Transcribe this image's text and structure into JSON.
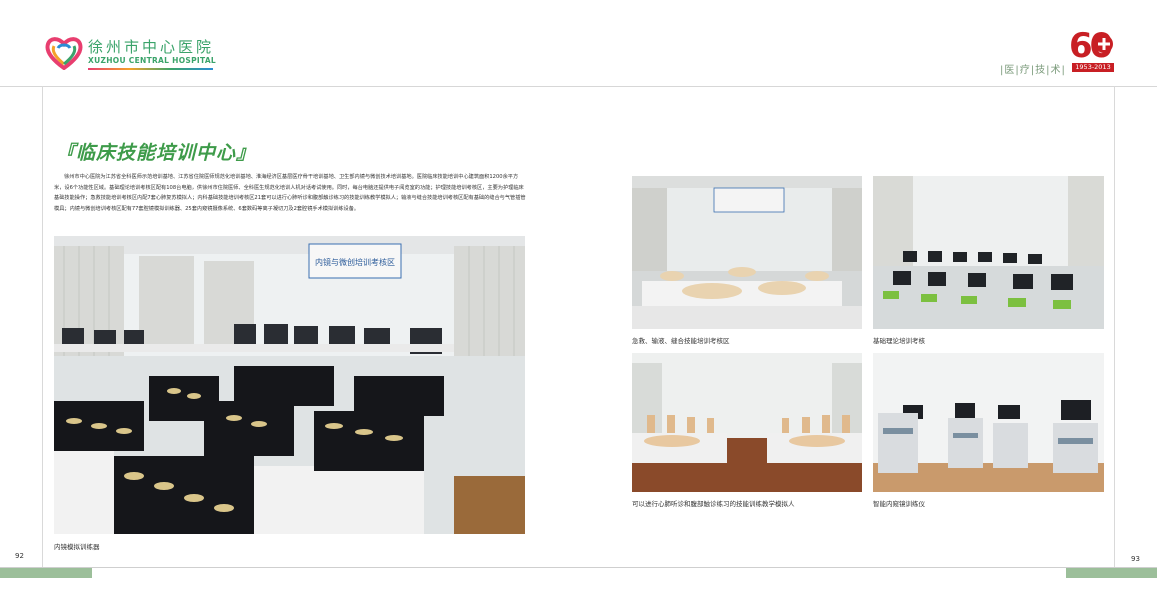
{
  "header": {
    "logo_cn": "徐州市中心医院",
    "logo_en": "XUZHOU CENTRAL HOSPITAL",
    "anniversary_mark": "60",
    "anniversary_years": "1953-2013",
    "section_tag": "|医|疗|技|术|"
  },
  "left_page": {
    "title": "『临床技能培训中心』",
    "body": "徐州市中心医院为江苏省全科医师示范培训基地、江苏省住院医师规范化培训基地、淮海经济区基层医疗骨干培训基地、卫生部内镜与微创技术培训基地。医院临床技能培训中心建筑面积1200余平方米，设6个功能性区域。基础理论培训考核区配有108台电脑，供徐州市住院医师、全科医生规范化培训人机对话考试使用。同时，每台电脑还提供电子阅览室的功能；护理技能培训考核区，主要为护理临床基础技能操作；急救技能培训考核区内配7套心肺复苏模拟人；内科基础技能培训考核区21套可以进行心肺听诊和腹部触诊练习的技能训练教学模拟人；输液与缝合技能培训考核区配有基础的缝合与气管插管模具；内镜与微创培训考核区配有77套腔镜模拟训练器、25套内窥镜摄像系统、6套数码等离子凝切刀及2套腔镜手术模拟训练设备。",
    "main_photo_sign": "内镜与微创培训考核区",
    "main_caption": "内镜模拟训练器",
    "page_number": "92"
  },
  "right_page": {
    "photos": [
      {
        "caption": "急救、输液、缝合技能培训考核区"
      },
      {
        "caption": "基础理论培训考核"
      },
      {
        "caption": "可以进行心肺听诊和腹部触诊练习的技能训练教学模拟人"
      },
      {
        "caption": "智能内窥镜训练仪"
      }
    ],
    "page_number": "93"
  },
  "colors": {
    "brand_green": "#3aa36a",
    "title_green": "#3e9b4a",
    "anniversary_red": "#c81f24",
    "footer_green": "#9cbf9a"
  }
}
